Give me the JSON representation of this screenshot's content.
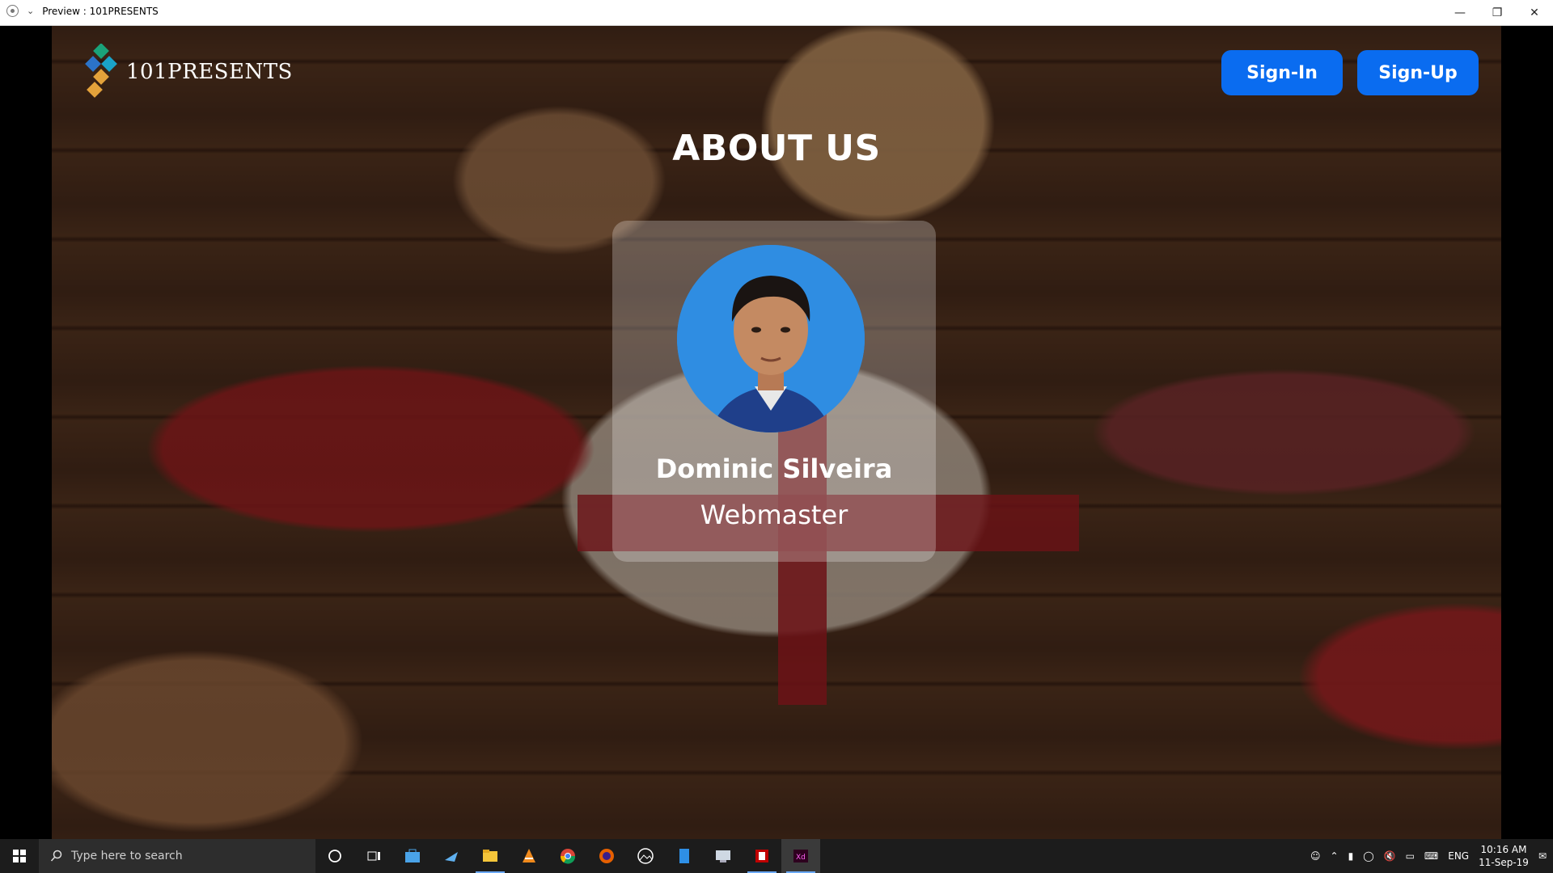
{
  "window": {
    "title": "Preview : 101PRESENTS",
    "controls": [
      "minimize",
      "restore",
      "close"
    ]
  },
  "site": {
    "logo_text": "101PRESENTS",
    "nav": {
      "signin_label": "Sign-In",
      "signup_label": "Sign-Up"
    },
    "page_title": "ABOUT US",
    "member": {
      "name": "Dominic Silveira",
      "role": "Webmaster"
    }
  },
  "taskbar": {
    "search_placeholder": "Type here to search",
    "language": "ENG",
    "time": "10:16 AM",
    "date": "11-Sep-19",
    "apps": [
      "cortana-icon",
      "task-view-icon",
      "store-icon",
      "sketch-icon",
      "file-explorer-icon",
      "vlc-icon",
      "chrome-icon",
      "firefox-icon",
      "photos-icon",
      "document-icon",
      "remote-desktop-icon",
      "filezilla-icon",
      "adobe-xd-icon"
    ]
  },
  "colors": {
    "accent": "#0a6cf0",
    "taskbar": "#1c1c1c"
  }
}
